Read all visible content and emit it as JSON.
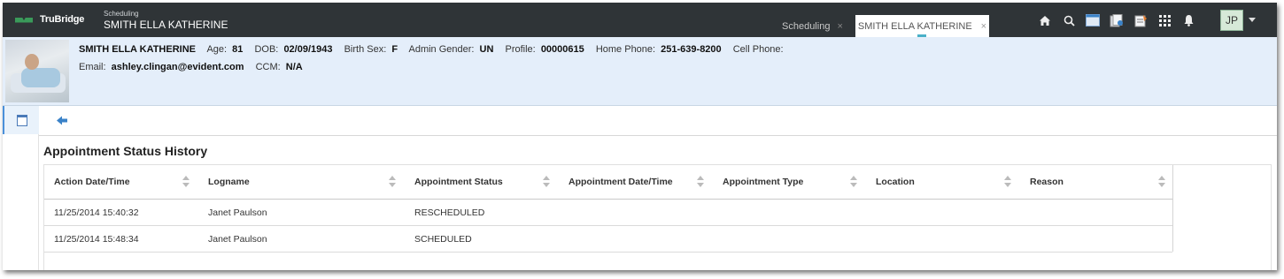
{
  "topbar": {
    "brand": "TruBridge",
    "module": "Scheduling",
    "patient_name": "SMITH ELLA KATHERINE",
    "tabs": [
      {
        "label": "Scheduling",
        "close": "×"
      },
      {
        "label": "SMITH ELLA KATHERINE",
        "close": "×"
      }
    ],
    "icons": [
      "home-icon",
      "search-icon",
      "calendar-icon",
      "documents-icon",
      "notes-icon",
      "apps-grid-icon",
      "bell-icon"
    ],
    "user_initials": "JP"
  },
  "patient": {
    "name": "SMITH ELLA KATHERINE",
    "age_label": "Age:",
    "age": "81",
    "dob_label": "DOB:",
    "dob": "02/09/1943",
    "birth_sex_label": "Birth Sex:",
    "birth_sex": "F",
    "admin_gender_label": "Admin Gender:",
    "admin_gender": "UN",
    "profile_label": "Profile:",
    "profile": "00000615",
    "home_phone_label": "Home Phone:",
    "home_phone": "251-639-8200",
    "cell_phone_label": "Cell Phone:",
    "email_label": "Email:",
    "email": "ashley.clingan@evident.com",
    "ccm_label": "CCM:",
    "ccm": "N/A"
  },
  "page": {
    "title": "Appointment Status History"
  },
  "table": {
    "columns": [
      "Action Date/Time",
      "Logname",
      "Appointment Status",
      "Appointment Date/Time",
      "Appointment Type",
      "Location",
      "Reason"
    ],
    "rows": [
      [
        "11/25/2014 15:40:32",
        "Janet Paulson",
        "RESCHEDULED",
        "",
        "",
        "",
        ""
      ],
      [
        "11/25/2014 15:48:34",
        "Janet Paulson",
        "SCHEDULED",
        "",
        "",
        "",
        ""
      ]
    ]
  },
  "colors": {
    "topbar": "#2f3437",
    "patient_banner": "#e4eefa",
    "accent": "#3a82c8"
  }
}
